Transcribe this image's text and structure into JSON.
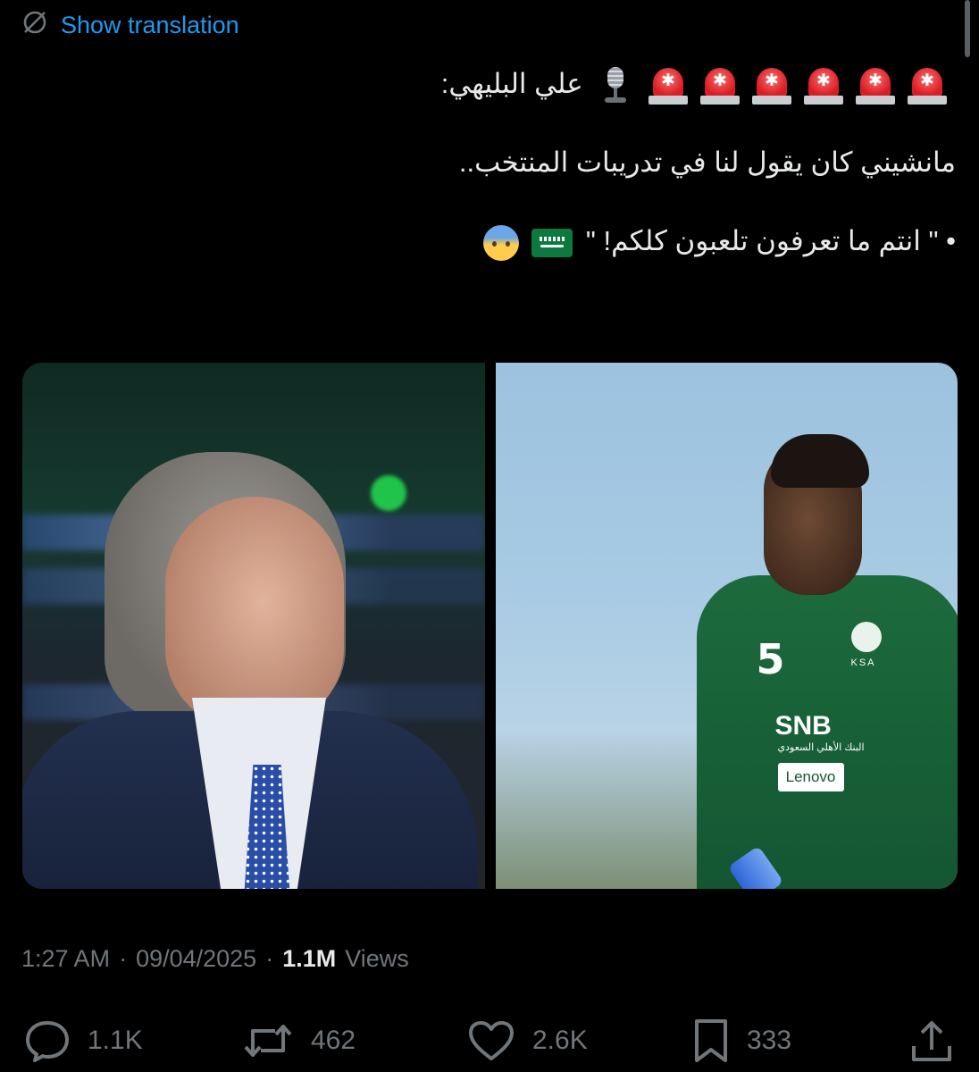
{
  "header": {
    "translate_label": "Show translation",
    "translate_icon": "globe-slash-icon"
  },
  "tweet": {
    "line1_text": "علي البليهي:",
    "line1_emoji": [
      "police-light-icon",
      "police-light-icon",
      "police-light-icon",
      "police-light-icon",
      "police-light-icon",
      "police-light-icon",
      "studio-microphone-icon"
    ],
    "line2_text": "مانشيني كان يقول لنا في تدريبات المنتخب..",
    "line3_text": "• \" انتم ما تعرفون تلعبون كلكم! \"",
    "line3_emoji": [
      "saudi-flag-icon",
      "anxious-sweat-face-icon"
    ]
  },
  "media": {
    "left_photo": "man-in-suit-photo",
    "right_photo": "player-in-green-jersey-photo",
    "jersey_number": "5",
    "jersey_ksa": "KSA",
    "jersey_sponsor": "SNB",
    "jersey_sponsor_ar": "البنك الأهلي السعودي",
    "jersey_brand": "Lenovo"
  },
  "meta": {
    "time": "1:27 AM",
    "separator": "·",
    "date": "09/04/2025",
    "views_count": "1.1M",
    "views_label": "Views"
  },
  "actions": {
    "replies": "1.1K",
    "reposts": "462",
    "likes": "2.6K",
    "bookmarks": "333"
  },
  "colors": {
    "background": "#000000",
    "link": "#1d9bf0",
    "text": "#e7e9ea",
    "muted": "#71767b"
  }
}
